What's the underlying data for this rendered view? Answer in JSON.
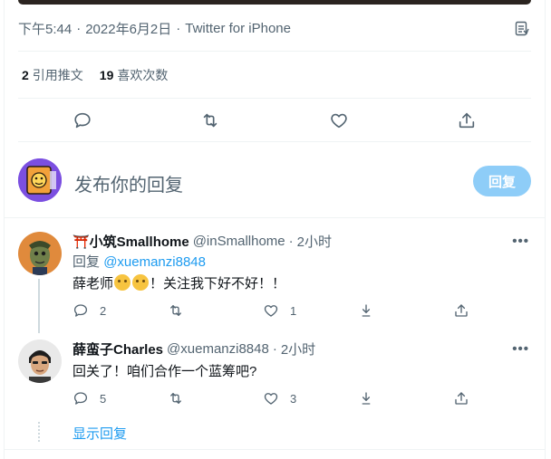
{
  "tweet_meta": {
    "time": "下午5:44",
    "separator": "·",
    "date": "2022年6月2日",
    "source": "Twitter for iPhone"
  },
  "stats": {
    "quotes_count": "2",
    "quotes_label": "引用推文",
    "likes_count": "19",
    "likes_label": "喜欢次数"
  },
  "composer": {
    "placeholder": "发布你的回复",
    "reply_button": "回复"
  },
  "replies": [
    {
      "name": "⛩️小筑Smallhome",
      "handle": "@inSmallhome",
      "dot": "·",
      "time": "2小时",
      "more": "•••",
      "reply_prefix": "回复",
      "reply_to": "@xuemanzi8848",
      "text_before": "薛老师",
      "text_after": "！关注我下好不好！！",
      "reply_count": "2",
      "retweet_count": "",
      "like_count": "1"
    },
    {
      "name": "薛蛮子Charles",
      "handle": "@xuemanzi8848",
      "dot": "·",
      "time": "2小时",
      "more": "•••",
      "text": "回关了！咱们合作一个蓝筹吧?",
      "reply_count": "5",
      "retweet_count": "",
      "like_count": "3"
    }
  ],
  "show_replies": "显示回复",
  "colors": {
    "accent": "#1d9bf0",
    "reply_button_disabled": "#8ecdf8",
    "secondary_text": "#536471"
  }
}
